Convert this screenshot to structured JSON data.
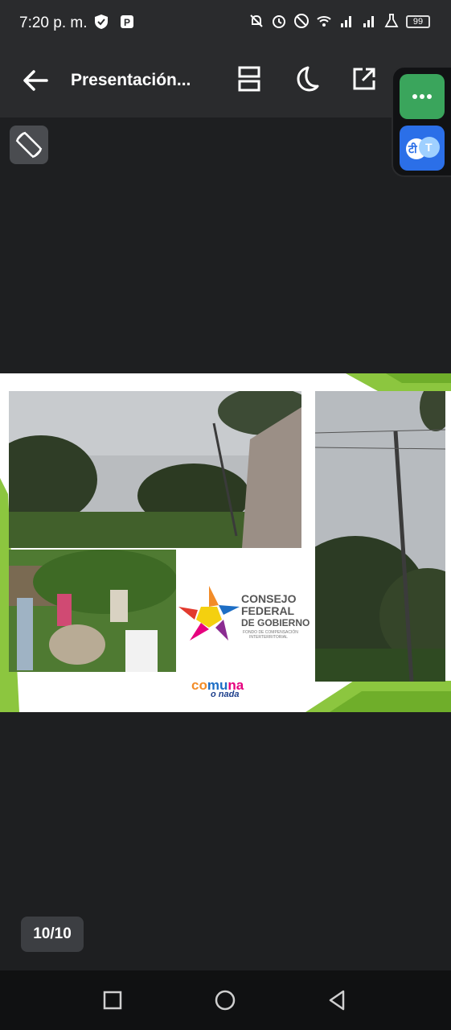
{
  "status": {
    "time": "7:20 p. m.",
    "battery": "99"
  },
  "toolbar": {
    "title": "Presentación...",
    "icons": [
      "back-arrow-icon",
      "page-layout-icon",
      "moon-icon",
      "open-external-icon"
    ]
  },
  "floating": {
    "more_label": "···",
    "translate_label": "T"
  },
  "slide": {
    "logo": {
      "line1": "CONSEJO",
      "line2": "FEDERAL",
      "line3": "DE GOBIERNO",
      "line4": "FONDO DE COMPENSACIÓN",
      "line5": "INTERTERRITORIAL"
    },
    "comuna": {
      "main": "comuna",
      "sub": "o nada"
    },
    "colors": {
      "green_accent": "#8cc63f",
      "logo_gray": "#555555",
      "comuna_orange": "#f28c28",
      "comuna_blue": "#1d6ec5",
      "comuna_pink": "#e6007e"
    }
  },
  "page_indicator": "10/10",
  "nav": [
    "recent-apps",
    "home",
    "back"
  ]
}
